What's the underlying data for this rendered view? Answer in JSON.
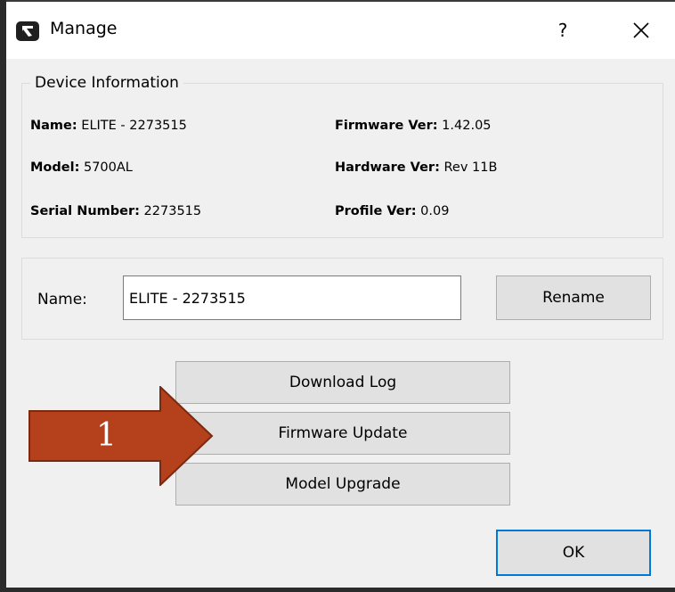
{
  "window": {
    "title": "Manage",
    "help_glyph": "?",
    "close_icon": "close-icon",
    "app_icon": "app-logo-icon"
  },
  "device_info": {
    "group_title": "Device Information",
    "name_label": "Name:",
    "name_value": "ELITE - 2273515",
    "model_label": "Model:",
    "model_value": "5700AL",
    "serial_label": "Serial Number:",
    "serial_value": "2273515",
    "firmware_label": "Firmware Ver:",
    "firmware_value": "1.42.05",
    "hardware_label": "Hardware Ver:",
    "hardware_value": "Rev 11B",
    "profile_label": "Profile Ver:",
    "profile_value": "0.09"
  },
  "rename": {
    "label": "Name:",
    "value": "ELITE - 2273515",
    "button": "Rename"
  },
  "actions": {
    "download_log": "Download Log",
    "firmware_update": "Firmware Update",
    "model_upgrade": "Model Upgrade",
    "ok": "OK"
  },
  "annotation": {
    "label": "1",
    "color": "#b5401c",
    "border_color": "#7a2a10"
  },
  "colors": {
    "dialog_bg": "#f0f0f0",
    "button_bg": "#e1e1e1",
    "default_button_border": "#0078d7"
  }
}
